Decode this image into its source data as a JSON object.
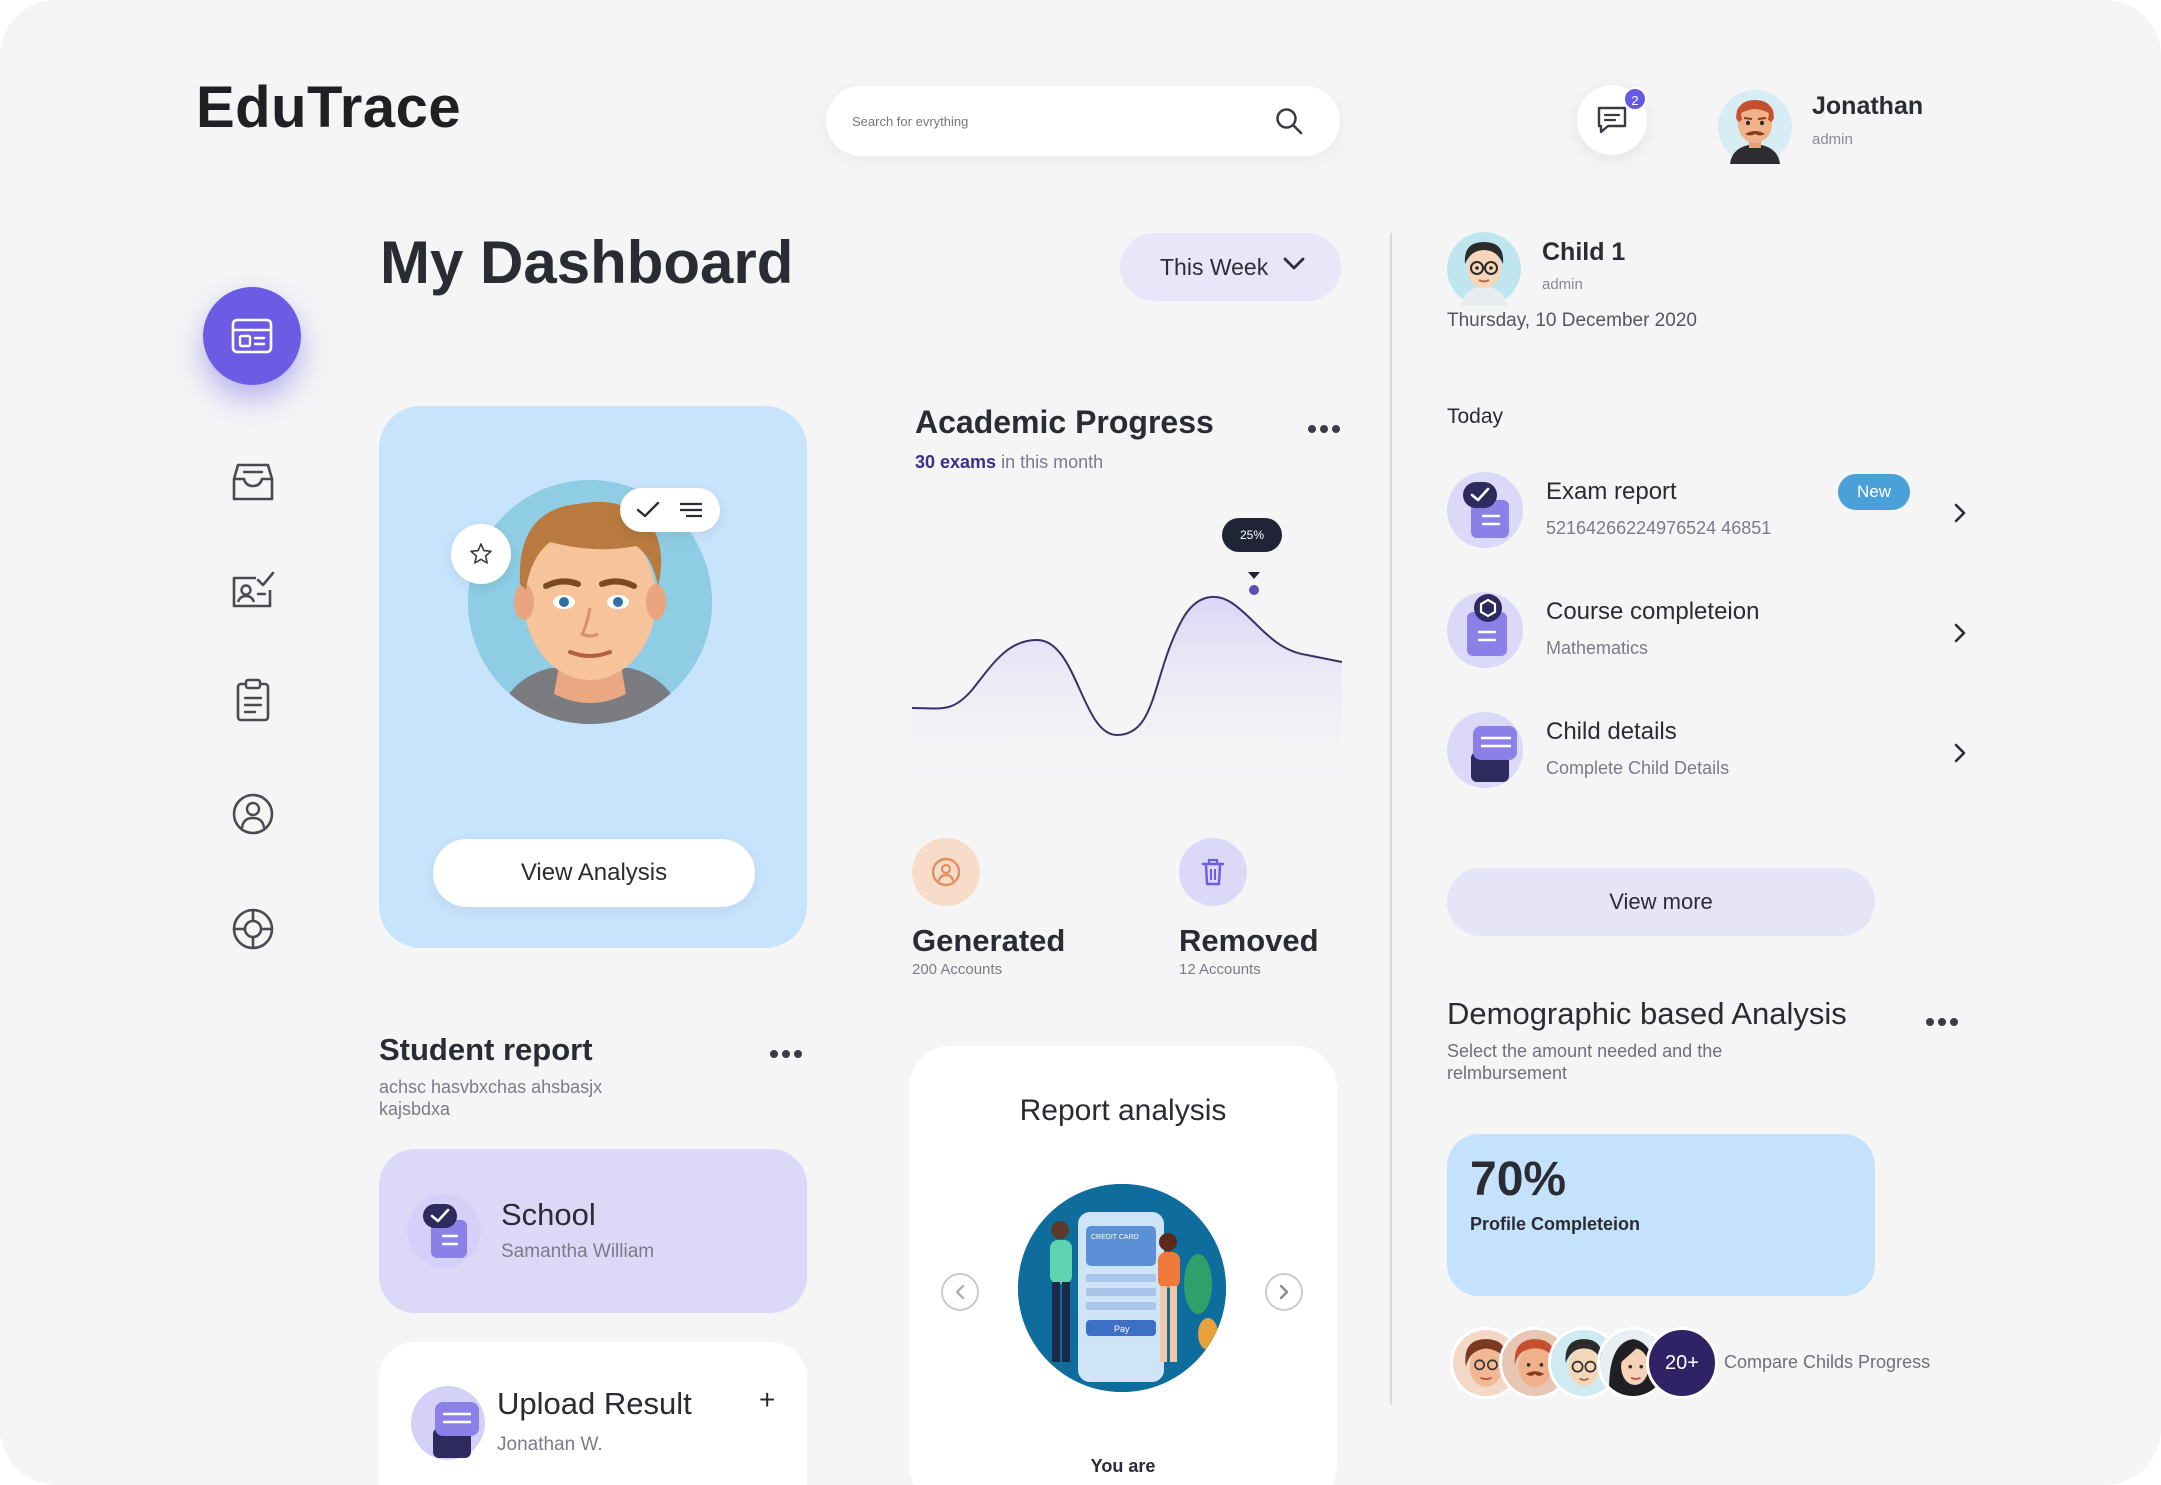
{
  "app": {
    "logo": "EduTrace"
  },
  "header": {
    "search_placeholder": "Search for evrything",
    "notifications_count": "2",
    "user": {
      "name": "Jonathan",
      "role": "admin"
    }
  },
  "sidebar": {
    "items": [
      {
        "icon": "dashboard-icon",
        "active": true
      },
      {
        "icon": "inbox-icon",
        "active": false
      },
      {
        "icon": "certificate-icon",
        "active": false
      },
      {
        "icon": "clipboard-icon",
        "active": false
      },
      {
        "icon": "profile-icon",
        "active": false
      },
      {
        "icon": "support-icon",
        "active": false
      }
    ]
  },
  "main": {
    "title": "My Dashboard",
    "period_select": "This Week",
    "profile_card": {
      "button": "View Analysis"
    },
    "academic": {
      "title": "Academic Progress",
      "exams_count": "30 exams",
      "exams_suffix": "in this month",
      "tooltip": "25%",
      "accent": "#6c5ce4"
    },
    "stats": [
      {
        "label": "Generated",
        "sub": "200 Accounts",
        "icon": "user-circle-icon",
        "color": "#f6dcc9"
      },
      {
        "label": "Removed",
        "sub": "12 Accounts",
        "icon": "trash-icon",
        "color": "#dcd8f8"
      }
    ],
    "student_report": {
      "title": "Student report",
      "subtitle": "achsc hasvbxchas ahsbasjx kajsbdxa",
      "school": {
        "title": "School",
        "sub": "Samantha William"
      },
      "upload": {
        "title": "Upload Result",
        "sub": "Jonathan W.",
        "plus": "+"
      }
    },
    "report_analysis": {
      "title": "Report analysis",
      "caption": "You are",
      "illustration_text": {
        "card": "CREDIT CARD",
        "pay": "Pay"
      }
    }
  },
  "right_panel": {
    "child": {
      "name": "Child 1",
      "role": "admin",
      "date": "Thursday, 10 December 2020"
    },
    "today_label": "Today",
    "tasks": [
      {
        "title": "Exam report",
        "sub": "52164266224976524 46851",
        "badge": "New"
      },
      {
        "title": "Course completeion",
        "sub": "Mathematics"
      },
      {
        "title": "Child details",
        "sub": "Complete Child Details"
      }
    ],
    "view_more": "View more",
    "demographic": {
      "title": "Demographic based Analysis",
      "subtitle": "Select the amount needed and the relmbursement",
      "percent": "70%",
      "percent_value": 70,
      "label": "Profile Completeion"
    },
    "compare": {
      "more": "20+",
      "label": "Compare Childs Progress"
    }
  }
}
